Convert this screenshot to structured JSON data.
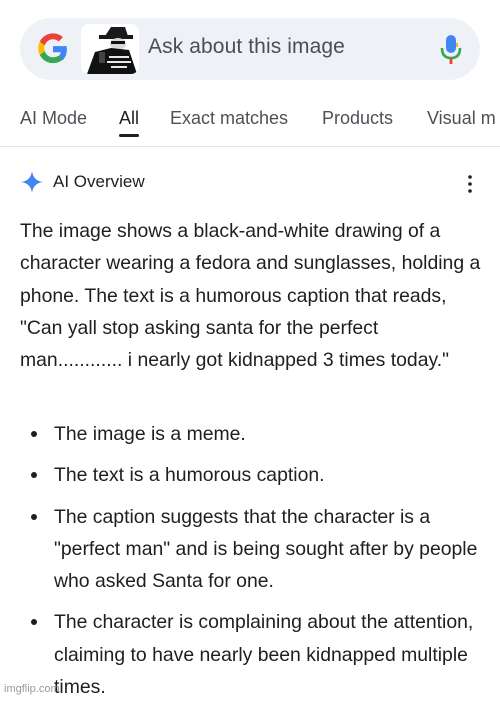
{
  "search": {
    "placeholder": "Ask about this image"
  },
  "tabs": [
    {
      "label": "AI Mode"
    },
    {
      "label": "All"
    },
    {
      "label": "Exact matches"
    },
    {
      "label": "Products"
    },
    {
      "label": "Visual m"
    }
  ],
  "active_tab": "All",
  "ai_overview": {
    "title": "AI Overview",
    "summary": "The image shows a black-and-white drawing of a character wearing a fedora and sunglasses, holding a phone. The text is a humorous caption that reads, \"Can yall stop asking santa for the perfect man............ i nearly got kidnapped 3 times today.\"",
    "bullets": [
      "The image is a meme.",
      "The text is a humorous caption.",
      "The caption suggests that the character is a \"perfect man\" and is being sought after by people who asked Santa for one.",
      "The character is complaining about the attention, claiming to have nearly been kidnapped multiple times."
    ]
  },
  "watermark": "imgflip.com",
  "colors": {
    "search_bg": "#eef2f7",
    "text": "#1f1f1f",
    "muted": "#4d5156",
    "sparkle": "#4285f4",
    "mic_blue": "#4285f4"
  },
  "icons": {
    "logo": "google-g-logo",
    "mic": "microphone-icon",
    "sparkle": "ai-sparkle-icon",
    "more": "more-vertical-icon"
  }
}
